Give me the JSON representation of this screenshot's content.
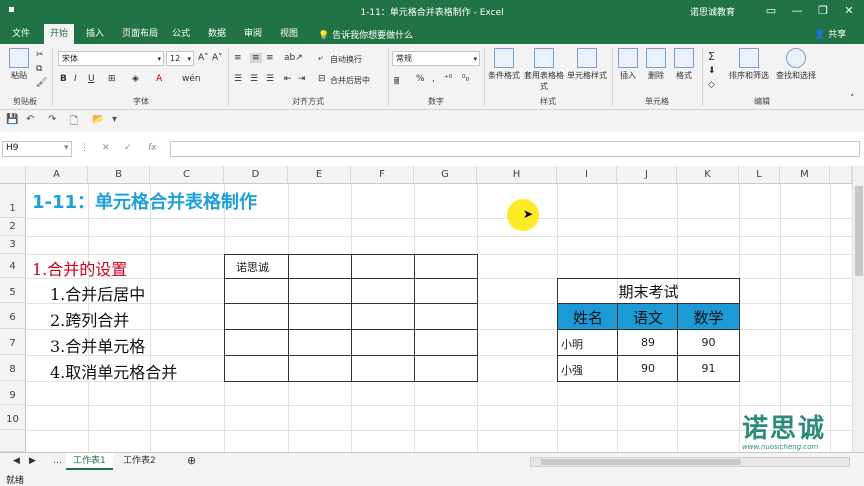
{
  "window": {
    "title": "1-11：单元格合并表格制作 - Excel",
    "user": "诺思诚教育",
    "share_label": "共享"
  },
  "ribbon": {
    "tabs": [
      "文件",
      "开始",
      "插入",
      "页面布局",
      "公式",
      "数据",
      "审阅",
      "视图"
    ],
    "active_tab": "开始",
    "tell_me": "告诉我你想要做什么",
    "groups": {
      "clipboard": "剪贴板",
      "font": "字体",
      "alignment": "对齐方式",
      "number": "数字",
      "styles": "样式",
      "cells": "单元格",
      "editing": "编辑"
    },
    "paste_label": "粘贴",
    "font_name": "宋体",
    "font_size": "12",
    "wrap_text": "自动换行",
    "merge_center": "合并后居中",
    "number_format": "常规",
    "conditional_format": "条件格式",
    "format_as_table": "套用表格格式",
    "cell_styles": "单元格样式",
    "insert": "插入",
    "delete": "删除",
    "format": "格式",
    "sort_filter": "排序和筛选",
    "find_select": "查找和选择"
  },
  "formula_bar": {
    "name_box": "H9",
    "fx": "fx",
    "formula": ""
  },
  "sheet": {
    "columns": [
      "A",
      "B",
      "C",
      "D",
      "E",
      "F",
      "G",
      "H",
      "I",
      "J",
      "K",
      "L",
      "M"
    ],
    "rows": [
      "1",
      "2",
      "3",
      "4",
      "5",
      "6",
      "7",
      "8",
      "9",
      "10"
    ],
    "title": "1-11：单元格合并表格制作",
    "section_heading": "1.合并的设置",
    "items": [
      "1.合并后居中",
      "2.跨列合并",
      "3.合并单元格",
      "4.取消单元格合并"
    ],
    "grid_label": "诺思诚",
    "exam_table": {
      "title": "期末考试",
      "headers": [
        "姓名",
        "语文",
        "数学"
      ],
      "rows": [
        [
          "小明",
          "89",
          "90"
        ],
        [
          "小强",
          "90",
          "91"
        ]
      ]
    }
  },
  "sheet_tabs": [
    "工作表1",
    "工作表2"
  ],
  "status": "就绪",
  "watermark": {
    "text": "诺思诚",
    "url": "www.nuosicheng.com"
  },
  "colors": {
    "excel_green": "#217346",
    "title_blue": "#1fa0d8",
    "heading_red": "#d0021b",
    "header_blue": "#1c9ad6"
  }
}
